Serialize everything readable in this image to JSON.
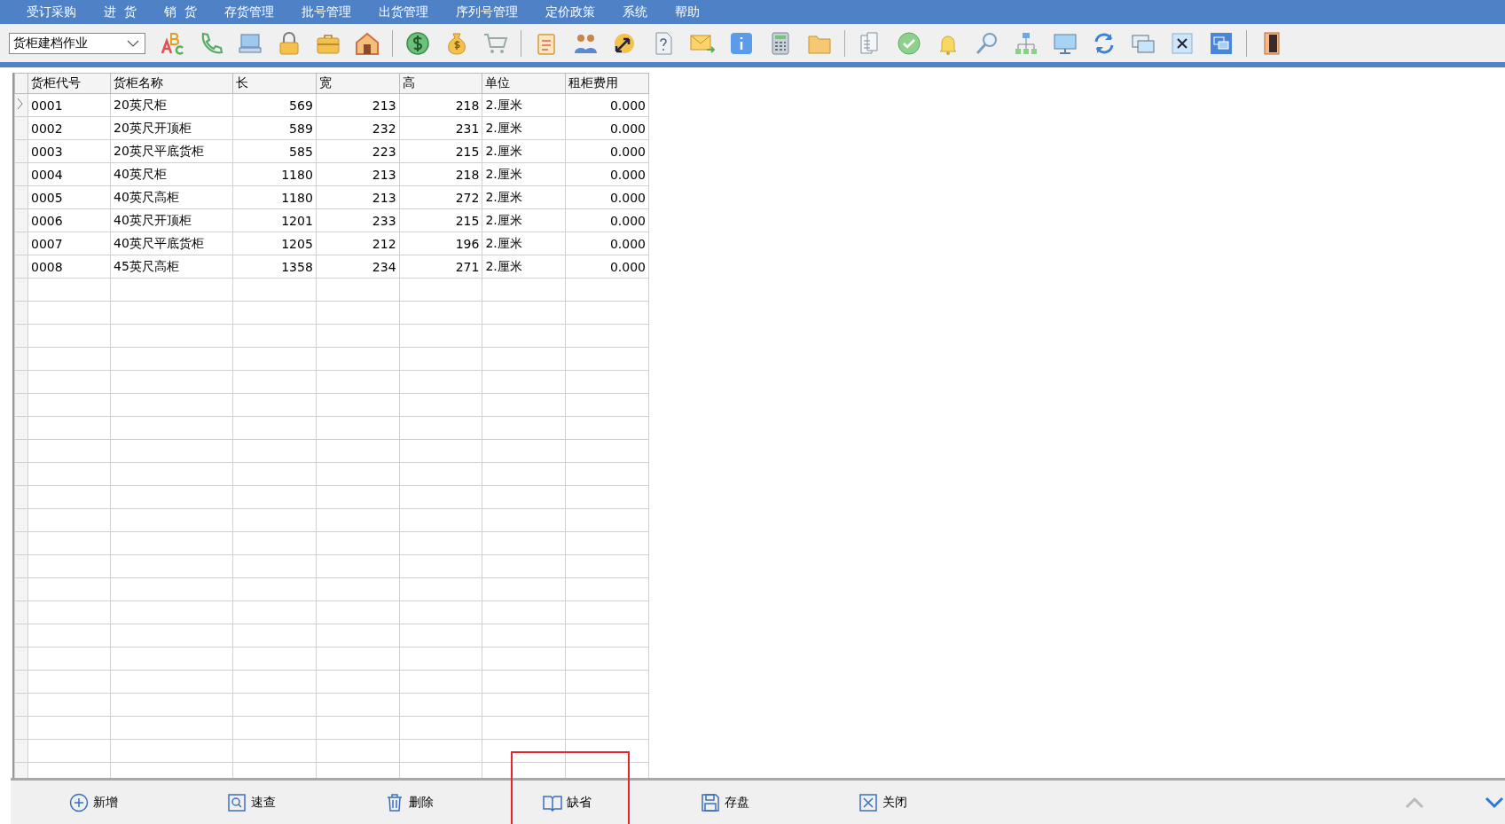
{
  "menu": [
    "受订采购",
    "进  货",
    "销  货",
    "存货管理",
    "批号管理",
    "出货管理",
    "序列号管理",
    "定价政策",
    "系统",
    "帮助"
  ],
  "module_select": {
    "value": "货柜建档作业"
  },
  "table": {
    "columns": [
      "货柜代号",
      "货柜名称",
      "长",
      "宽",
      "高",
      "单位",
      "租柜费用"
    ],
    "rows": [
      {
        "current": true,
        "cells": [
          "0001",
          "20英尺柜",
          "569",
          "213",
          "218",
          "2.厘米",
          "0.000"
        ]
      },
      {
        "current": false,
        "cells": [
          "0002",
          "20英尺开顶柜",
          "589",
          "232",
          "231",
          "2.厘米",
          "0.000"
        ]
      },
      {
        "current": false,
        "cells": [
          "0003",
          "20英尺平底货柜",
          "585",
          "223",
          "215",
          "2.厘米",
          "0.000"
        ]
      },
      {
        "current": false,
        "cells": [
          "0004",
          "40英尺柜",
          "1180",
          "213",
          "218",
          "2.厘米",
          "0.000"
        ]
      },
      {
        "current": false,
        "cells": [
          "0005",
          "40英尺高柜",
          "1180",
          "213",
          "272",
          "2.厘米",
          "0.000"
        ]
      },
      {
        "current": false,
        "cells": [
          "0006",
          "40英尺开顶柜",
          "1201",
          "233",
          "215",
          "2.厘米",
          "0.000"
        ]
      },
      {
        "current": false,
        "cells": [
          "0007",
          "40英尺平底货柜",
          "1205",
          "212",
          "196",
          "2.厘米",
          "0.000"
        ]
      },
      {
        "current": false,
        "cells": [
          "0008",
          "45英尺高柜",
          "1358",
          "234",
          "271",
          "2.厘米",
          "0.000"
        ]
      }
    ]
  },
  "actions": [
    {
      "kind": "add",
      "label": "新增",
      "highlighted": false
    },
    {
      "kind": "search",
      "label": "速查",
      "highlighted": false
    },
    {
      "kind": "delete",
      "label": "删除",
      "highlighted": false
    },
    {
      "kind": "default",
      "label": "缺省",
      "highlighted": true
    },
    {
      "kind": "save",
      "label": "存盘",
      "highlighted": false
    },
    {
      "kind": "close",
      "label": "关闭",
      "highlighted": false
    }
  ]
}
